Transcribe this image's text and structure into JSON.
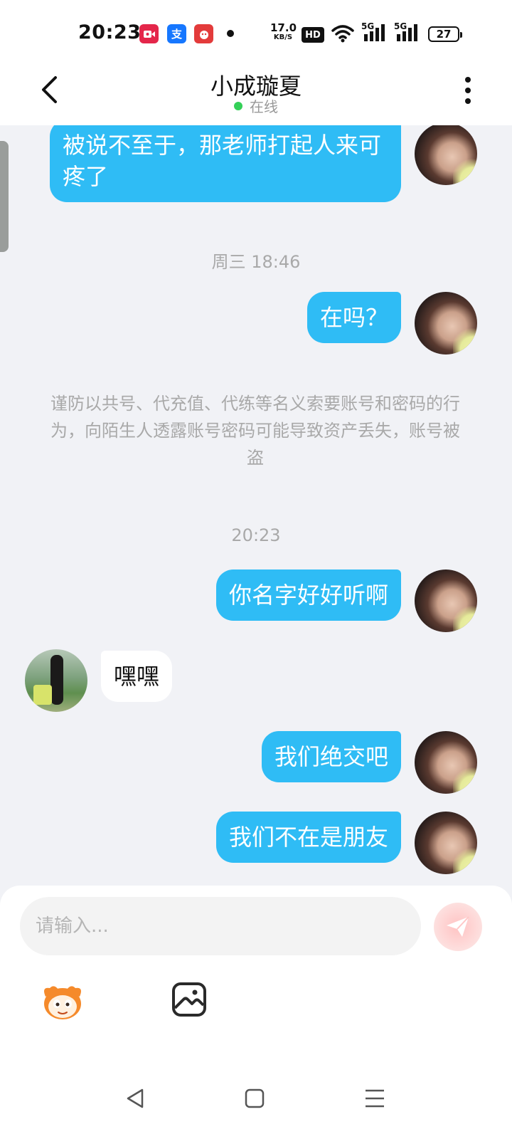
{
  "status_bar": {
    "time": "20:23",
    "net_speed_value": "17.0",
    "net_speed_unit": "KB/S",
    "hd_label": "HD",
    "sig1_label": "5G",
    "sig2_label": "5G",
    "battery": "27",
    "app_icons": [
      "video-app-icon",
      "alipay-icon",
      "shopping-app-icon"
    ]
  },
  "header": {
    "title": "小成璇夏",
    "status": "在线"
  },
  "messages": {
    "m1": "被说不至于，那老师打起人来可疼了",
    "t1": "周三 18:46",
    "m2": "在吗？",
    "notice": "谨防以共号、代充值、代练等名义索要账号和密码的行为，向陌生人透露账号密码可能导致资产丢失，账号被盗",
    "t2": "20:23",
    "m3": "你名字好好听啊",
    "m4": "嘿嘿",
    "m5": "我们绝交吧",
    "m6": "我们不在是朋友"
  },
  "input": {
    "placeholder": "请输入..."
  },
  "colors": {
    "accent": "#2fbcf5",
    "online": "#34d058",
    "background": "#f1f2f6"
  }
}
